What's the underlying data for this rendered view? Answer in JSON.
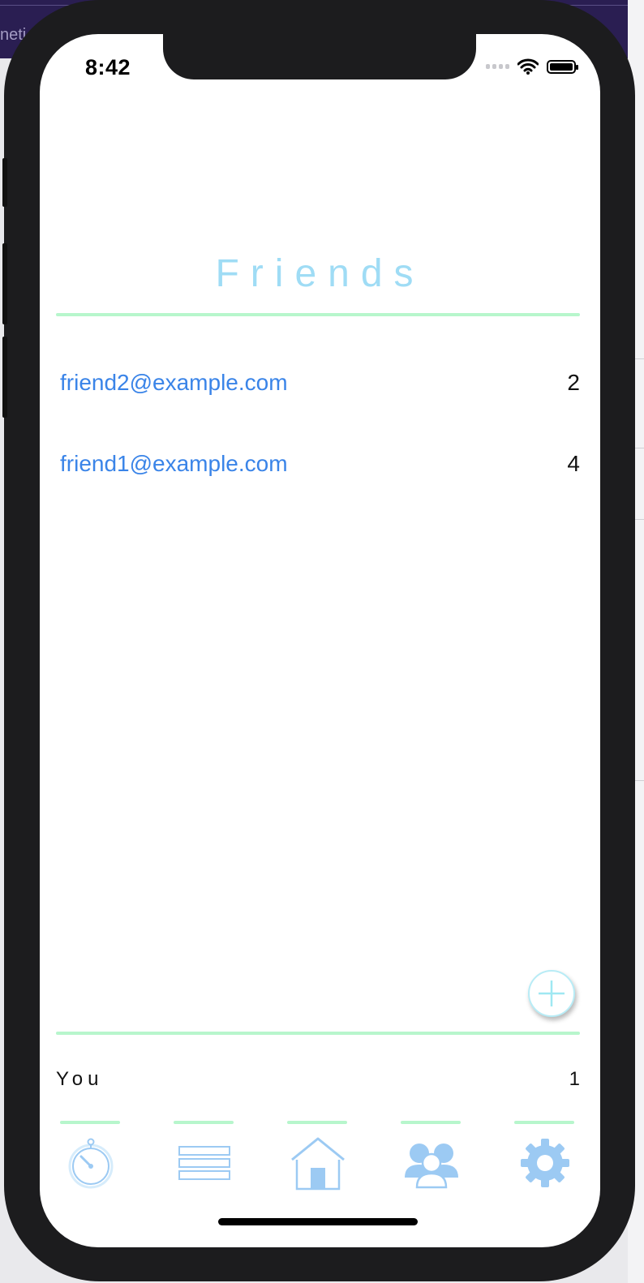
{
  "background": {
    "fragment_text": "neti"
  },
  "status_bar": {
    "time": "8:42"
  },
  "page": {
    "title": "Friends",
    "accent_color": "#9fdcf5",
    "rule_color": "#b7f6cc",
    "link_color": "#3a84e8"
  },
  "friends": [
    {
      "email": "friend2@example.com",
      "count": "2"
    },
    {
      "email": "friend1@example.com",
      "count": "4"
    }
  ],
  "add_button": {
    "icon": "plus-icon"
  },
  "you": {
    "label": "You",
    "count": "1"
  },
  "tabbar": {
    "tabs": [
      {
        "icon": "stopwatch-icon"
      },
      {
        "icon": "list-icon"
      },
      {
        "icon": "home-icon"
      },
      {
        "icon": "friends-icon"
      },
      {
        "icon": "gear-icon"
      }
    ]
  }
}
